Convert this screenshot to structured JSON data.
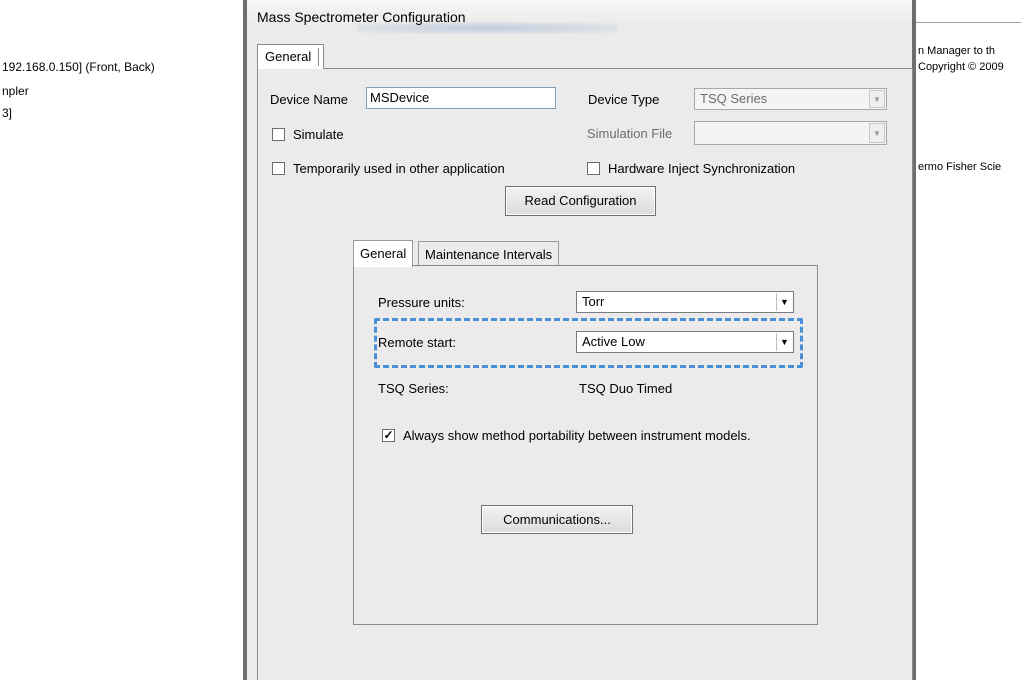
{
  "background": {
    "left_lines": [
      "192.168.0.150] (Front, Back)",
      "npler",
      "3]"
    ],
    "right_lines": [
      "n Manager to th",
      "Copyright © 2009",
      "ermo Fisher Scie"
    ]
  },
  "dialog": {
    "title": "Mass Spectrometer Configuration",
    "outer_tab": "General",
    "device_name_label": "Device Name",
    "device_name_value": "MSDevice",
    "device_type_label": "Device Type",
    "device_type_value": "TSQ Series",
    "simulate_label": "Simulate",
    "simulate_checked": false,
    "simulation_file_label": "Simulation File",
    "simulation_file_value": "",
    "temp_used_label": "Temporarily used in other application",
    "temp_used_checked": false,
    "hw_inject_label": "Hardware Inject Synchronization",
    "hw_inject_checked": false,
    "read_config_button": "Read Configuration",
    "inner_tabs": [
      "General",
      "Maintenance Intervals"
    ],
    "pressure_units_label": "Pressure units:",
    "pressure_units_value": "Torr",
    "remote_start_label": "Remote start:",
    "remote_start_value": "Active Low",
    "tsq_series_label": "TSQ Series:",
    "tsq_series_value": "TSQ Duo Timed",
    "always_show_label": "Always show method portability between instrument models.",
    "always_show_checked": true,
    "communications_button": "Communications..."
  },
  "colors": {
    "highlight": "#4a90d9",
    "dialog_bg": "#ebebeb",
    "window_border": "#6e6e6e"
  }
}
